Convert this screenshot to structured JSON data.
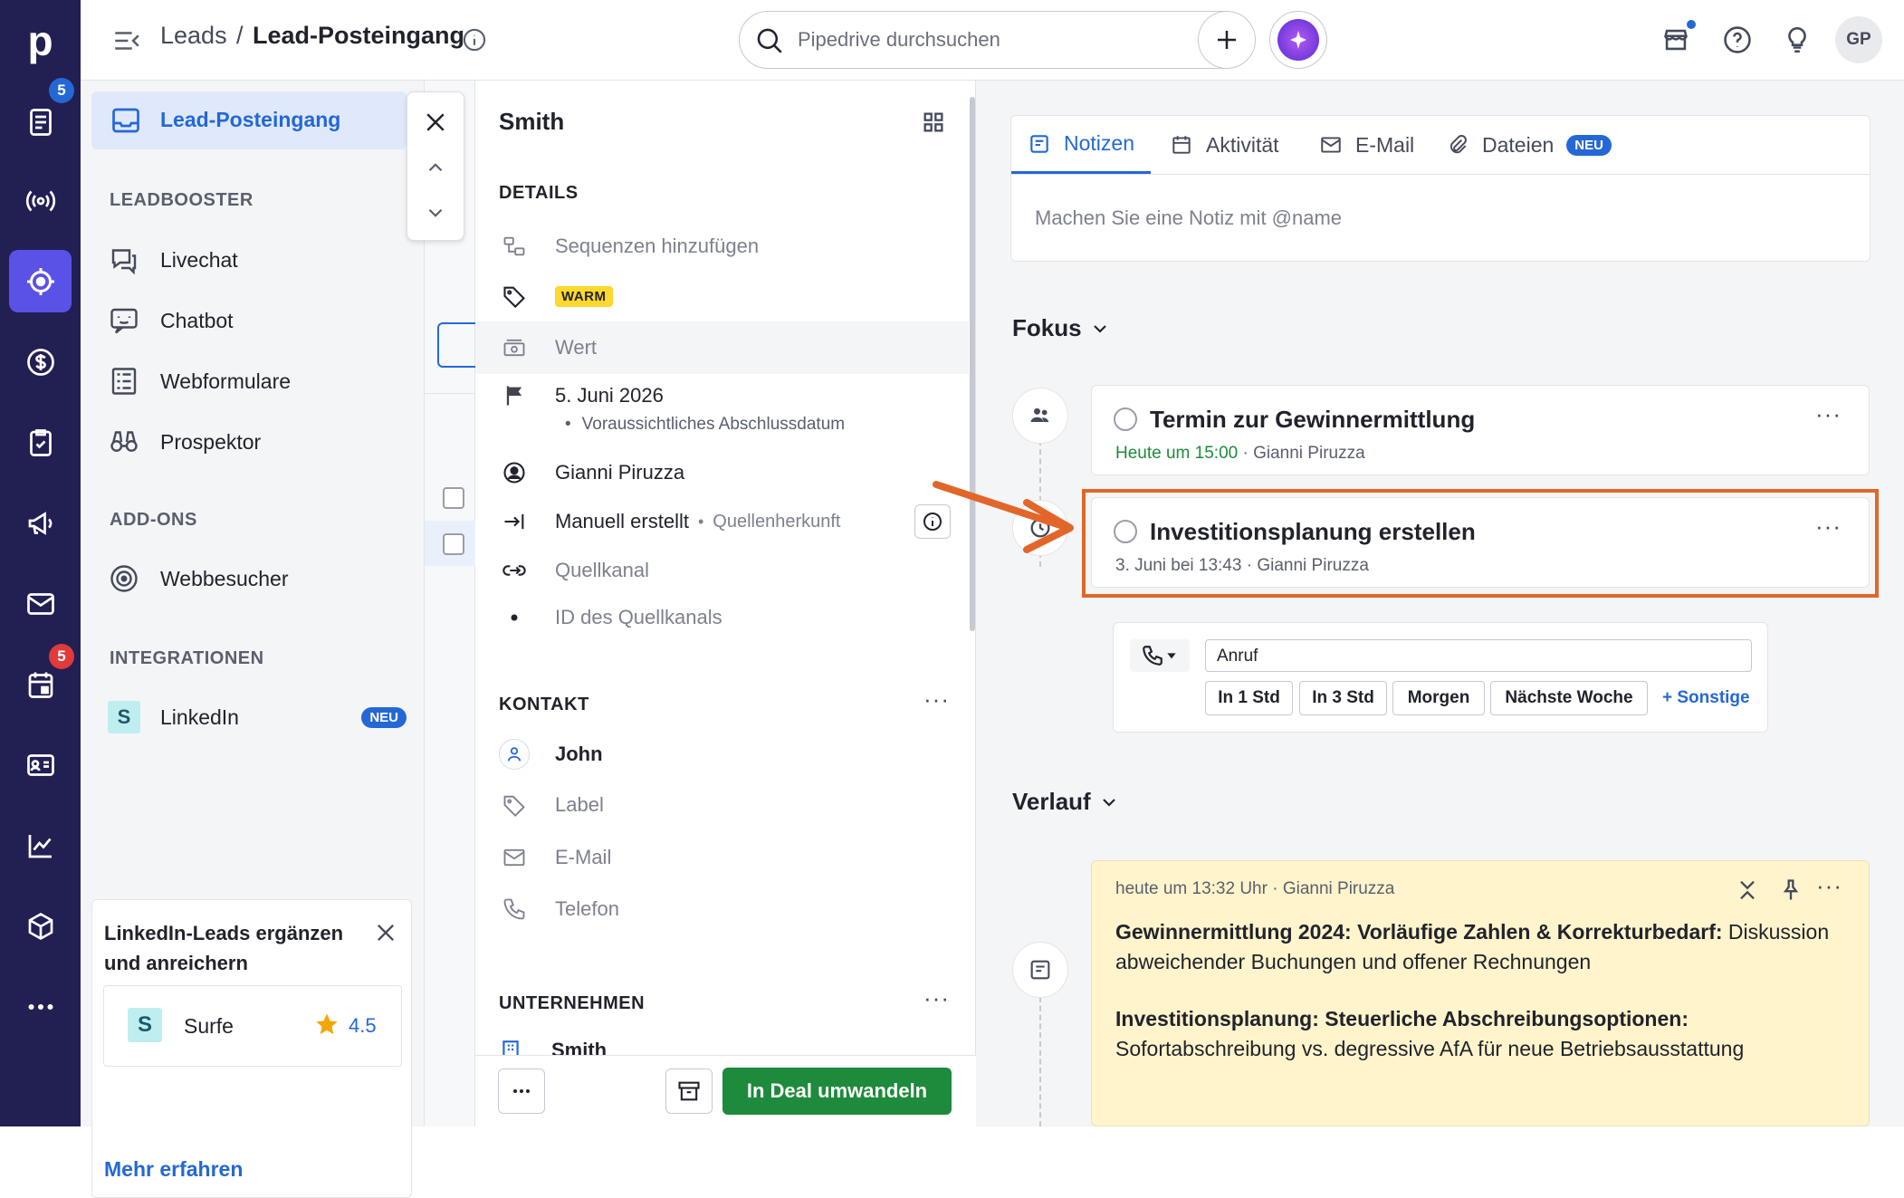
{
  "rail": {
    "logo": "p",
    "badges": {
      "activities_count": "5",
      "calendar_count": "5"
    },
    "icons": [
      "leads-icon",
      "radar-icon",
      "target-icon",
      "dollar-icon",
      "clipboard-icon",
      "megaphone-icon",
      "mail-icon",
      "calendar-icon",
      "contacts-icon",
      "chart-icon",
      "box-icon",
      "more-icon"
    ],
    "colors": {
      "bg": "#221f53",
      "active": "#5a52e6",
      "badge": "#2468d6",
      "badge_red": "#e03a3a"
    }
  },
  "topbar": {
    "crumb_parent": "Leads",
    "crumb_sep": "/",
    "crumb_current": "Lead-Posteingang",
    "search_placeholder": "Pipedrive durchsuchen",
    "avatar_initials": "GP"
  },
  "leftnav": {
    "active_item": "Lead-Posteingang",
    "section_leadbooster": "LEADBOOSTER",
    "items_leadbooster": [
      "Livechat",
      "Chatbot",
      "Webformulare",
      "Prospektor"
    ],
    "section_addons": "ADD-ONS",
    "item_webbesucher": "Webbesucher",
    "section_integrationen": "INTEGRATIONEN",
    "item_linkedin": "LinkedIn",
    "badge_neu": "NEU",
    "promo": {
      "title": "LinkedIn-Leads ergänzen und anreichern",
      "app_name": "Surfe",
      "rating": "4.5",
      "link": "Mehr erfahren"
    }
  },
  "detail": {
    "title": "Smith",
    "section_details": "DETAILS",
    "sequenzen": "Sequenzen hinzufügen",
    "label_tag": "WARM",
    "wert": "Wert",
    "close_date": "5. Juni 2026",
    "close_date_caption": "Voraussichtliches Abschlussdatum",
    "owner": "Gianni Piruzza",
    "source": "Manuell erstellt",
    "source_caption": "Quellenherkunft",
    "quellkanal": "Quellkanal",
    "quellkanal_id": "ID des Quellkanals",
    "section_kontakt": "KONTAKT",
    "contact_name": "John",
    "contact_label": "Label",
    "contact_email": "E-Mail",
    "contact_phone": "Telefon",
    "section_unternehmen": "UNTERNEHMEN",
    "company_partial": "Smith",
    "convert_button": "In Deal umwandeln",
    "more": "···"
  },
  "right": {
    "tabs": {
      "notizen": "Notizen",
      "aktivitaet": "Aktivität",
      "email": "E-Mail",
      "dateien": "Dateien",
      "dateien_badge": "NEU"
    },
    "note_placeholder": "Machen Sie eine Notiz mit @name",
    "fokus": "Fokus",
    "activity1": {
      "title": "Termin zur Gewinnermittlung",
      "time": "Heute um 15:00",
      "sep": "·",
      "owner": "Gianni Piruzza"
    },
    "activity2": {
      "title": "Investitionsplanung erstellen",
      "time": "3. Juni bei 13:43",
      "sep": "·",
      "owner": "Gianni Piruzza"
    },
    "quick": {
      "input": "Anruf",
      "b1": "In 1 Std",
      "b2": "In 3 Std",
      "b3": "Morgen",
      "b4": "Nächste Woche",
      "b5": "+ Sonstige"
    },
    "verlauf": "Verlauf",
    "note": {
      "meta": "heute um 13:32 Uhr · Gianni Piruzza",
      "p1_bold": "Gewinnermittlung 2024: Vorläufige Zahlen & Korrekturbedarf:",
      "p1_rest": " Diskussion abweichender Buchungen und offener Rechnungen",
      "p2_bold": "Investitionsplanung: Steuerliche Abschreibungsoptionen:",
      "p2_rest": " Sofortabschreibung vs. degressive AfA für neue Betriebsausstattung"
    }
  },
  "colors": {
    "accent": "#2468d6",
    "green": "#1e8a3c",
    "highlight": "#e2662a",
    "warm": "#ffd72e",
    "note_bg": "#fff4cc"
  }
}
